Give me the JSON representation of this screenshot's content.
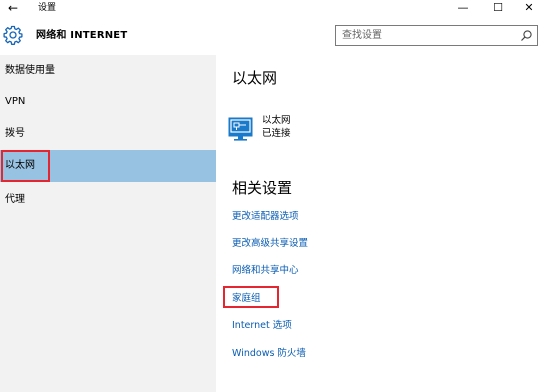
{
  "window": {
    "back_glyph": "←",
    "title": "设置",
    "minimize_glyph": "—",
    "maximize_glyph": "☐",
    "close_glyph": "✕"
  },
  "header": {
    "icon": "gear-icon",
    "title": "网络和 INTERNET",
    "search_placeholder": "查找设置",
    "search_icon": "search-icon"
  },
  "sidebar": {
    "items": [
      {
        "label": "数据使用量",
        "selected": false
      },
      {
        "label": "VPN",
        "selected": false
      },
      {
        "label": "拨号",
        "selected": false
      },
      {
        "label": "以太网",
        "selected": true
      },
      {
        "label": "代理",
        "selected": false
      }
    ]
  },
  "main": {
    "section_title": "以太网",
    "connection": {
      "icon": "ethernet-icon",
      "name": "以太网",
      "status": "已连接"
    },
    "related_title": "相关设置",
    "links": [
      "更改适配器选项",
      "更改高级共享设置",
      "网络和共享中心",
      "家庭组",
      "Internet 选项",
      "Windows 防火墙"
    ]
  },
  "colors": {
    "accent": "#0a5db3",
    "selected_bg": "#98c2e2",
    "sidebar_bg": "#f2f2f2",
    "highlight": "#e3262f",
    "icon_blue": "#1979ca"
  }
}
